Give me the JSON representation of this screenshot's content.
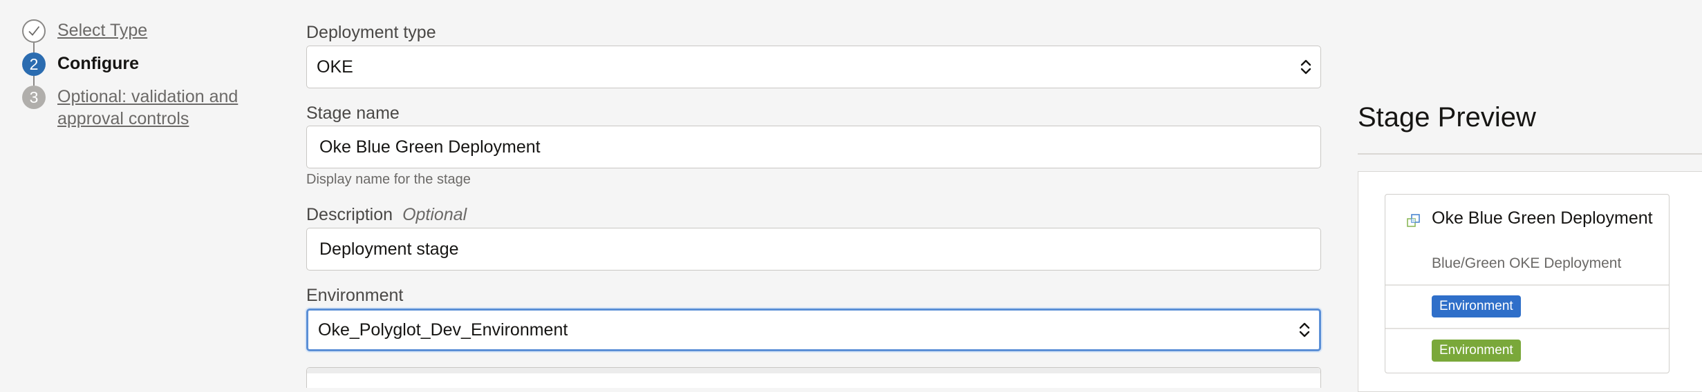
{
  "stepper": {
    "steps": [
      {
        "number": "",
        "label": "Select Type",
        "state": "done",
        "icon": "check-icon"
      },
      {
        "number": "2",
        "label": "Configure",
        "state": "current"
      },
      {
        "number": "3",
        "label": "Optional: validation and approval controls",
        "state": "pending"
      }
    ]
  },
  "form": {
    "deployment_type": {
      "label": "Deployment type",
      "value": "OKE"
    },
    "stage_name": {
      "label": "Stage name",
      "value": "Oke Blue Green Deployment",
      "help": "Display name for the stage"
    },
    "description": {
      "label": "Description",
      "optional": "Optional",
      "value": "Deployment stage"
    },
    "environment": {
      "label": "Environment",
      "value": "Oke_Polyglot_Dev_Environment"
    }
  },
  "preview": {
    "title": "Stage Preview",
    "card": {
      "name": "Oke Blue Green Deployment",
      "subtitle": "Blue/Green OKE Deployment",
      "badges": [
        {
          "label": "Environment",
          "color": "#2f6fc9"
        },
        {
          "label": "Environment",
          "color": "#7aa83a"
        }
      ]
    }
  }
}
